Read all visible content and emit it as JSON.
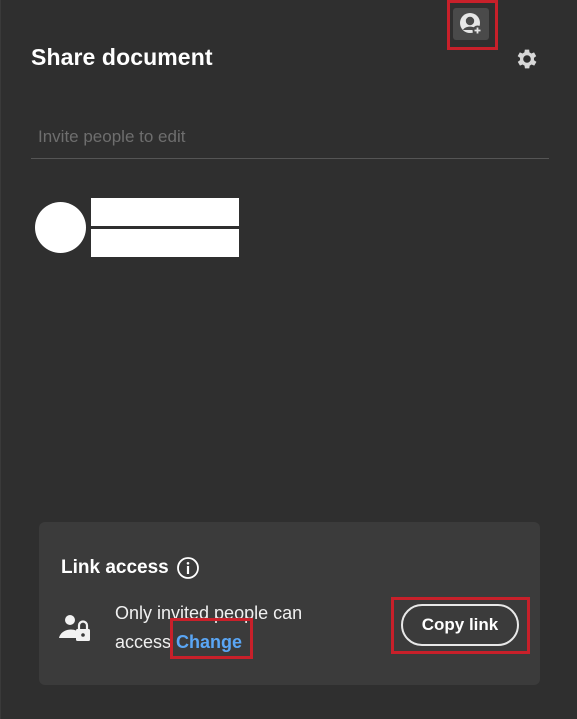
{
  "header": {
    "title": "Share document",
    "share_icon": "add-person-icon",
    "settings_icon": "gear-icon"
  },
  "invite": {
    "placeholder": "Invite people to edit"
  },
  "people": [
    {
      "avatar": "redacted-avatar",
      "name": "",
      "email": ""
    }
  ],
  "link_access": {
    "title": "Link access",
    "info_icon": "info-icon",
    "access_icon": "restricted-person-lock-icon",
    "description": "Only invited people can access",
    "change_label": "Change",
    "copy_label": "Copy link"
  },
  "colors": {
    "background": "#2f2f2f",
    "card": "#3b3b3b",
    "link": "#5aa6f5",
    "highlight": "#c8202a"
  }
}
